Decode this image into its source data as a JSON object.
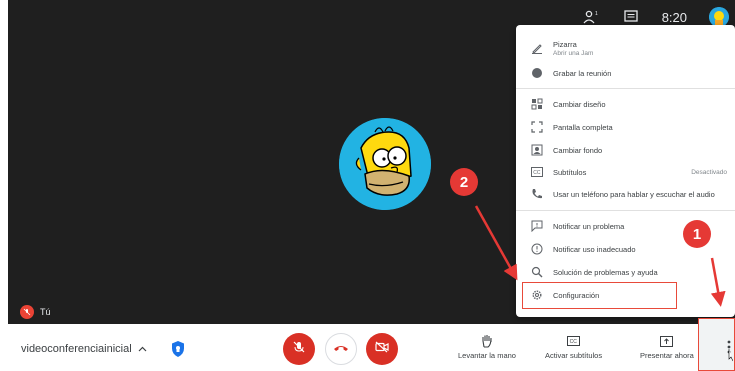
{
  "topbar": {
    "participants_icon": "people-icon",
    "chat_icon": "chat-icon",
    "time": "8:20"
  },
  "stage": {
    "self_label": "Tú"
  },
  "menu": {
    "items": [
      {
        "icon": "pen-icon",
        "label": "Pizarra",
        "sub": "Abrir una Jam"
      },
      {
        "icon": "record-icon",
        "label": "Grabar la reunión"
      },
      {
        "icon": "layout-icon",
        "label": "Cambiar diseño"
      },
      {
        "icon": "fullscreen-icon",
        "label": "Pantalla completa"
      },
      {
        "icon": "background-icon",
        "label": "Cambiar fondo"
      },
      {
        "icon": "captions-icon",
        "label": "Subtítulos",
        "status": "Desactivado"
      },
      {
        "icon": "phone-icon",
        "label": "Usar un teléfono para hablar y escuchar el audio"
      },
      {
        "icon": "feedback-icon",
        "label": "Notificar un problema"
      },
      {
        "icon": "report-icon",
        "label": "Notificar uso inadecuado"
      },
      {
        "icon": "troubleshoot-icon",
        "label": "Solución de problemas y ayuda"
      },
      {
        "icon": "settings-gear-icon",
        "label": "Configuración"
      }
    ]
  },
  "bottom": {
    "meeting_name": "videoconferenciainicial",
    "raise_hand": "Levantar la mano",
    "captions": "Activar subtítulos",
    "present": "Presentar ahora"
  },
  "annotations": {
    "badge_1": "1",
    "badge_2": "2"
  },
  "colors": {
    "stage": "#1f1f1f",
    "accent_red": "#d93025",
    "annotation_red": "#e53935"
  }
}
